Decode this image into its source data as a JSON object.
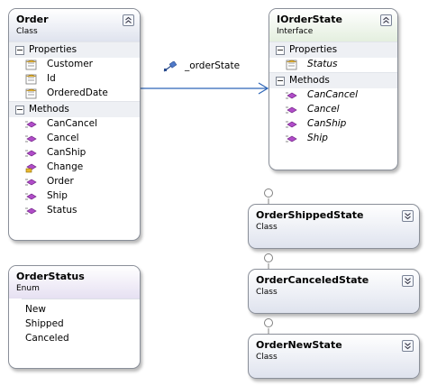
{
  "classes": {
    "order": {
      "name": "Order",
      "kind": "Class",
      "sections": [
        {
          "label": "Properties",
          "items": [
            "Customer",
            "Id",
            "OrderedDate"
          ]
        },
        {
          "label": "Methods",
          "items": [
            "CanCancel",
            "Cancel",
            "CanShip",
            "Change",
            "Order",
            "Ship",
            "Status"
          ]
        }
      ]
    },
    "iorderstate": {
      "name": "IOrderState",
      "kind": "Interface",
      "sections": [
        {
          "label": "Properties",
          "items": [
            "Status"
          ]
        },
        {
          "label": "Methods",
          "items": [
            "CanCancel",
            "Cancel",
            "CanShip",
            "Ship"
          ]
        }
      ]
    },
    "orderstatus": {
      "name": "OrderStatus",
      "kind": "Enum",
      "values": [
        "New",
        "Shipped",
        "Canceled"
      ]
    },
    "orderShippedState": {
      "name": "OrderShippedState",
      "kind": "Class"
    },
    "orderCanceledState": {
      "name": "OrderCanceledState",
      "kind": "Class"
    },
    "orderNewState": {
      "name": "OrderNewState",
      "kind": "Class"
    }
  },
  "association": {
    "label": "_orderState"
  },
  "icons": {
    "property": "property-icon",
    "method": "method-icon",
    "method_protected": "protected-method-icon",
    "association": "association-icon",
    "collapse": "collapse-chevrons-icon",
    "expand": "expand-chevrons-icon",
    "lollipop": "interface-lollipop-icon"
  },
  "colors": {
    "header_class": "#dfe3ee",
    "header_interface": "#e4efdf",
    "header_enum": "#e6e0f2",
    "section_bg": "#eef0f4",
    "border": "#8a8f99",
    "method_icon": "#b04cc8",
    "connector": "#2e66b7"
  }
}
